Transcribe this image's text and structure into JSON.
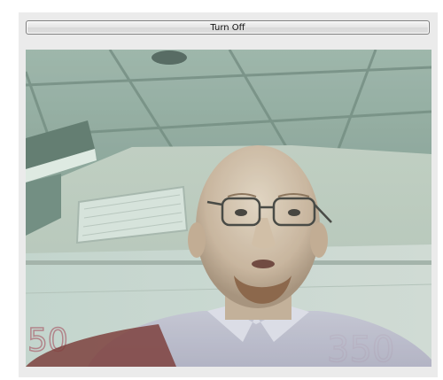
{
  "toolbar": {
    "toggle_button_label": "Turn Off"
  },
  "video": {
    "content": "webcam-feed",
    "whiteboard_numbers": [
      "50",
      "350"
    ]
  },
  "colors": {
    "window_background": "#ebebeb",
    "button_border": "#7c7c7c"
  }
}
